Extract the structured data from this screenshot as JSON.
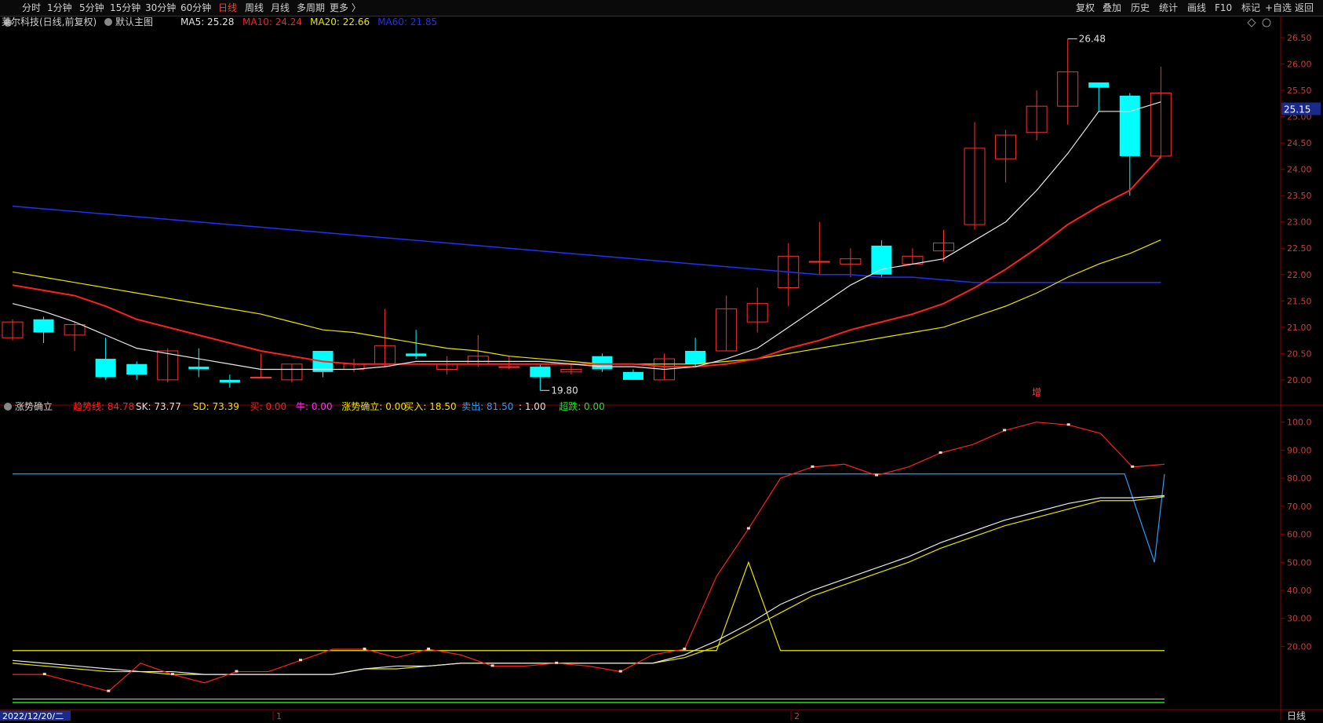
{
  "toolbar": {
    "left": [
      "分时",
      "1分钟",
      "5分钟",
      "15分钟",
      "30分钟",
      "60分钟",
      "日线",
      "周线",
      "月线",
      "多周期",
      "更多 〉"
    ],
    "active": "日线",
    "right": [
      "复权",
      "叠加",
      "历史",
      "统计",
      "画线",
      "F10",
      "标记",
      "+自选",
      "返回"
    ]
  },
  "main": {
    "title": "莱尔科技(日线,前复权)",
    "indicator_name": "默认主图",
    "ma": [
      {
        "label": "MA5: 25.28",
        "color": "#e0e0e0"
      },
      {
        "label": "MA10: 24.24",
        "color": "#ff2020"
      },
      {
        "label": "MA20: 22.66",
        "color": "#e6e600"
      },
      {
        "label": "MA60: 21.85",
        "color": "#2030ff"
      }
    ],
    "high_label": "26.48",
    "low_label": "19.80",
    "price_tag": "25.15",
    "marker": "增",
    "y_ticks": [
      "26.50",
      "26.00",
      "25.50",
      "25.00",
      "24.50",
      "24.00",
      "23.50",
      "23.00",
      "22.50",
      "22.00",
      "21.50",
      "21.00",
      "20.50",
      "20.00"
    ]
  },
  "sub": {
    "name": "涨势确立",
    "values": [
      {
        "label": "趋势线: 84.78",
        "color": "#ff2020"
      },
      {
        "label": "SK: 73.77",
        "color": "#e0e0e0"
      },
      {
        "label": "SD: 73.39",
        "color": "#e6e600"
      },
      {
        "label": "买: 0.00",
        "color": "#ff2020"
      },
      {
        "label": "牛: 0.00",
        "color": "#ff30ff"
      },
      {
        "label": "涨势确立: 0.00",
        "color": "#e6e600"
      },
      {
        "label": "买入: 18.50",
        "color": "#e6e600"
      },
      {
        "label": "卖出: 81.50",
        "color": "#2a9df4"
      },
      {
        "label": ": 1.00",
        "color": "#e0e0e0"
      },
      {
        "label": "超跌: 0.00",
        "color": "#20e020"
      }
    ],
    "y_ticks": [
      "100.0",
      "90.00",
      "80.00",
      "70.00",
      "60.00",
      "50.00",
      "40.00",
      "30.00",
      "20.00"
    ]
  },
  "footer": {
    "date": "2022/12/20/二",
    "m1": "1",
    "m2": "2",
    "period": "日线"
  },
  "chart_data": {
    "type": "candlestick",
    "candles": [
      [
        20.8,
        21.1,
        21.15,
        20.75
      ],
      [
        21.15,
        20.9,
        21.2,
        20.7
      ],
      [
        20.85,
        21.05,
        21.1,
        20.55
      ],
      [
        20.4,
        20.05,
        20.8,
        20.0
      ],
      [
        20.3,
        20.1,
        20.35,
        20.0
      ],
      [
        20.0,
        20.55,
        20.6,
        19.95
      ],
      [
        20.25,
        20.2,
        20.6,
        20.05
      ],
      [
        20.0,
        19.95,
        20.1,
        19.85
      ],
      [
        20.05,
        20.05,
        20.5,
        20.05
      ],
      [
        20.0,
        20.3,
        20.3,
        19.95
      ],
      [
        20.55,
        20.15,
        20.55,
        20.05
      ],
      [
        20.2,
        20.3,
        20.4,
        20.15
      ],
      [
        20.3,
        20.65,
        21.35,
        20.25
      ],
      [
        20.5,
        20.45,
        20.95,
        20.4
      ],
      [
        20.2,
        20.3,
        20.45,
        20.1
      ],
      [
        20.3,
        20.45,
        20.85,
        20.25
      ],
      [
        20.25,
        20.25,
        20.45,
        20.2
      ],
      [
        20.25,
        20.05,
        20.3,
        19.8
      ],
      [
        20.15,
        20.2,
        20.3,
        20.1
      ],
      [
        20.45,
        20.2,
        20.5,
        20.15
      ],
      [
        20.15,
        20.0,
        20.2,
        20.0
      ],
      [
        20.0,
        20.4,
        20.5,
        20.0
      ],
      [
        20.55,
        20.3,
        20.8,
        20.25
      ],
      [
        20.55,
        21.35,
        21.6,
        20.55
      ],
      [
        21.1,
        21.45,
        21.75,
        20.9
      ],
      [
        21.75,
        22.35,
        22.6,
        21.4
      ],
      [
        22.25,
        22.25,
        23.0,
        22.0
      ],
      [
        22.2,
        22.3,
        22.5,
        21.95
      ],
      [
        22.55,
        22.0,
        22.65,
        21.95
      ],
      [
        22.2,
        22.35,
        22.5,
        22.2
      ],
      [
        22.45,
        22.6,
        22.85,
        22.25
      ],
      [
        22.95,
        24.4,
        24.9,
        22.85
      ],
      [
        24.2,
        24.65,
        24.75,
        23.75
      ],
      [
        24.7,
        25.2,
        25.5,
        24.55
      ],
      [
        25.2,
        25.85,
        26.48,
        24.85
      ],
      [
        25.65,
        25.55,
        25.65,
        25.1
      ],
      [
        25.4,
        24.25,
        25.45,
        23.5
      ],
      [
        24.25,
        25.45,
        25.95,
        24.2
      ]
    ],
    "ma5": [
      21.45,
      21.3,
      21.1,
      20.85,
      20.6,
      20.5,
      20.4,
      20.3,
      20.2,
      20.2,
      20.2,
      20.2,
      20.25,
      20.35,
      20.35,
      20.35,
      20.35,
      20.35,
      20.3,
      20.25,
      20.25,
      20.2,
      20.25,
      20.4,
      20.6,
      21.0,
      21.4,
      21.8,
      22.1,
      22.2,
      22.3,
      22.65,
      23.0,
      23.6,
      24.3,
      25.1,
      25.1,
      25.28
    ],
    "ma10": [
      21.8,
      21.7,
      21.6,
      21.4,
      21.15,
      21.0,
      20.85,
      20.7,
      20.55,
      20.45,
      20.35,
      20.3,
      20.3,
      20.3,
      20.3,
      20.3,
      20.3,
      20.3,
      20.3,
      20.3,
      20.3,
      20.25,
      20.25,
      20.3,
      20.4,
      20.6,
      20.75,
      20.95,
      21.1,
      21.25,
      21.45,
      21.75,
      22.1,
      22.5,
      22.95,
      23.3,
      23.6,
      24.24
    ],
    "ma20": [
      22.05,
      21.95,
      21.85,
      21.75,
      21.65,
      21.55,
      21.45,
      21.35,
      21.25,
      21.1,
      20.95,
      20.9,
      20.8,
      20.7,
      20.6,
      20.55,
      20.45,
      20.4,
      20.35,
      20.3,
      20.3,
      20.3,
      20.3,
      20.35,
      20.4,
      20.5,
      20.6,
      20.7,
      20.8,
      20.9,
      21.0,
      21.2,
      21.4,
      21.65,
      21.95,
      22.2,
      22.4,
      22.66
    ],
    "ma60": [
      23.3,
      23.25,
      23.2,
      23.15,
      23.1,
      23.05,
      23.0,
      22.95,
      22.9,
      22.85,
      22.8,
      22.75,
      22.7,
      22.65,
      22.6,
      22.55,
      22.5,
      22.45,
      22.4,
      22.35,
      22.3,
      22.25,
      22.2,
      22.15,
      22.1,
      22.05,
      22.0,
      22.0,
      21.95,
      21.95,
      21.9,
      21.85,
      21.85,
      21.85,
      21.85,
      21.85,
      21.85,
      21.85
    ],
    "sub_trend": [
      10,
      10,
      7,
      4,
      14,
      10,
      7,
      11,
      11,
      15,
      19,
      19,
      16,
      19,
      17,
      13,
      13,
      14,
      13,
      11,
      17,
      19,
      45,
      62,
      80,
      84,
      85,
      81,
      84,
      89,
      92,
      97,
      100,
      99,
      96,
      84,
      85
    ],
    "sub_sk": [
      15,
      14,
      13,
      12,
      11,
      11,
      10,
      10,
      10,
      10,
      10,
      12,
      13,
      13,
      14,
      14,
      14,
      14,
      14,
      14,
      14,
      17,
      22,
      28,
      35,
      40,
      44,
      48,
      52,
      57,
      61,
      65,
      68,
      71,
      73,
      73,
      73.77
    ],
    "sub_sd": [
      14,
      13,
      12,
      11,
      11,
      10,
      10,
      10,
      10,
      10,
      10,
      12,
      12,
      13,
      14,
      14,
      14,
      14,
      14,
      14,
      14,
      16,
      20,
      26,
      32,
      38,
      42,
      46,
      50,
      55,
      59,
      63,
      66,
      69,
      72,
      72,
      73.39
    ],
    "sub_buy_line": 18.5,
    "sub_sell_line": 81.5,
    "sub_sell_dip": 50,
    "sub_spike": 50
  }
}
